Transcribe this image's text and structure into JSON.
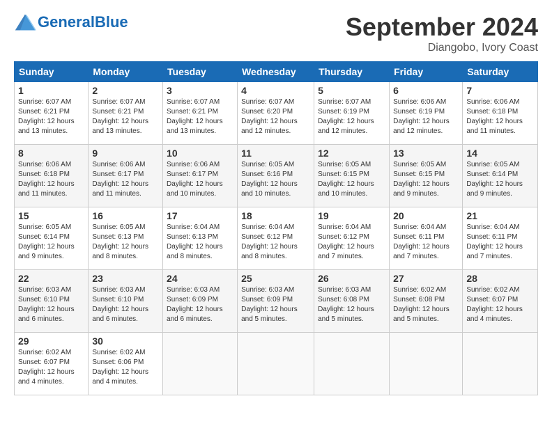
{
  "header": {
    "logo_text_general": "General",
    "logo_text_blue": "Blue",
    "month_title": "September 2024",
    "location": "Diangobo, Ivory Coast"
  },
  "weekdays": [
    "Sunday",
    "Monday",
    "Tuesday",
    "Wednesday",
    "Thursday",
    "Friday",
    "Saturday"
  ],
  "weeks": [
    [
      {
        "day": "1",
        "sunrise": "6:07 AM",
        "sunset": "6:21 PM",
        "daylight": "12 hours and 13 minutes."
      },
      {
        "day": "2",
        "sunrise": "6:07 AM",
        "sunset": "6:21 PM",
        "daylight": "12 hours and 13 minutes."
      },
      {
        "day": "3",
        "sunrise": "6:07 AM",
        "sunset": "6:21 PM",
        "daylight": "12 hours and 13 minutes."
      },
      {
        "day": "4",
        "sunrise": "6:07 AM",
        "sunset": "6:20 PM",
        "daylight": "12 hours and 12 minutes."
      },
      {
        "day": "5",
        "sunrise": "6:07 AM",
        "sunset": "6:19 PM",
        "daylight": "12 hours and 12 minutes."
      },
      {
        "day": "6",
        "sunrise": "6:06 AM",
        "sunset": "6:19 PM",
        "daylight": "12 hours and 12 minutes."
      },
      {
        "day": "7",
        "sunrise": "6:06 AM",
        "sunset": "6:18 PM",
        "daylight": "12 hours and 11 minutes."
      }
    ],
    [
      {
        "day": "8",
        "sunrise": "6:06 AM",
        "sunset": "6:18 PM",
        "daylight": "12 hours and 11 minutes."
      },
      {
        "day": "9",
        "sunrise": "6:06 AM",
        "sunset": "6:17 PM",
        "daylight": "12 hours and 11 minutes."
      },
      {
        "day": "10",
        "sunrise": "6:06 AM",
        "sunset": "6:17 PM",
        "daylight": "12 hours and 10 minutes."
      },
      {
        "day": "11",
        "sunrise": "6:05 AM",
        "sunset": "6:16 PM",
        "daylight": "12 hours and 10 minutes."
      },
      {
        "day": "12",
        "sunrise": "6:05 AM",
        "sunset": "6:15 PM",
        "daylight": "12 hours and 10 minutes."
      },
      {
        "day": "13",
        "sunrise": "6:05 AM",
        "sunset": "6:15 PM",
        "daylight": "12 hours and 9 minutes."
      },
      {
        "day": "14",
        "sunrise": "6:05 AM",
        "sunset": "6:14 PM",
        "daylight": "12 hours and 9 minutes."
      }
    ],
    [
      {
        "day": "15",
        "sunrise": "6:05 AM",
        "sunset": "6:14 PM",
        "daylight": "12 hours and 9 minutes."
      },
      {
        "day": "16",
        "sunrise": "6:05 AM",
        "sunset": "6:13 PM",
        "daylight": "12 hours and 8 minutes."
      },
      {
        "day": "17",
        "sunrise": "6:04 AM",
        "sunset": "6:13 PM",
        "daylight": "12 hours and 8 minutes."
      },
      {
        "day": "18",
        "sunrise": "6:04 AM",
        "sunset": "6:12 PM",
        "daylight": "12 hours and 8 minutes."
      },
      {
        "day": "19",
        "sunrise": "6:04 AM",
        "sunset": "6:12 PM",
        "daylight": "12 hours and 7 minutes."
      },
      {
        "day": "20",
        "sunrise": "6:04 AM",
        "sunset": "6:11 PM",
        "daylight": "12 hours and 7 minutes."
      },
      {
        "day": "21",
        "sunrise": "6:04 AM",
        "sunset": "6:11 PM",
        "daylight": "12 hours and 7 minutes."
      }
    ],
    [
      {
        "day": "22",
        "sunrise": "6:03 AM",
        "sunset": "6:10 PM",
        "daylight": "12 hours and 6 minutes."
      },
      {
        "day": "23",
        "sunrise": "6:03 AM",
        "sunset": "6:10 PM",
        "daylight": "12 hours and 6 minutes."
      },
      {
        "day": "24",
        "sunrise": "6:03 AM",
        "sunset": "6:09 PM",
        "daylight": "12 hours and 6 minutes."
      },
      {
        "day": "25",
        "sunrise": "6:03 AM",
        "sunset": "6:09 PM",
        "daylight": "12 hours and 5 minutes."
      },
      {
        "day": "26",
        "sunrise": "6:03 AM",
        "sunset": "6:08 PM",
        "daylight": "12 hours and 5 minutes."
      },
      {
        "day": "27",
        "sunrise": "6:02 AM",
        "sunset": "6:08 PM",
        "daylight": "12 hours and 5 minutes."
      },
      {
        "day": "28",
        "sunrise": "6:02 AM",
        "sunset": "6:07 PM",
        "daylight": "12 hours and 4 minutes."
      }
    ],
    [
      {
        "day": "29",
        "sunrise": "6:02 AM",
        "sunset": "6:07 PM",
        "daylight": "12 hours and 4 minutes."
      },
      {
        "day": "30",
        "sunrise": "6:02 AM",
        "sunset": "6:06 PM",
        "daylight": "12 hours and 4 minutes."
      },
      null,
      null,
      null,
      null,
      null
    ]
  ]
}
